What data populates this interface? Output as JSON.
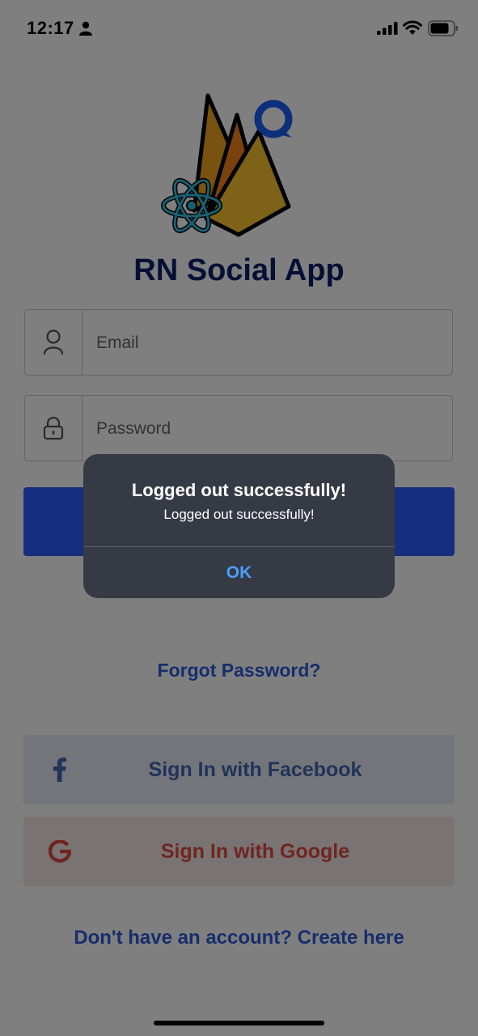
{
  "status_bar": {
    "time": "12:17",
    "icons": [
      "person-icon",
      "cellular-signal-icon",
      "wifi-icon",
      "battery-icon"
    ]
  },
  "app": {
    "title": "RN Social App",
    "logo": "firebase-react-chat-logo"
  },
  "form": {
    "email_placeholder": "Email",
    "email_value": "",
    "password_placeholder": "Password",
    "password_value": "",
    "email_icon": "user-icon",
    "password_icon": "lock-icon"
  },
  "links": {
    "forgot_password": "Forgot Password?",
    "create_account": "Don't have an account? Create here"
  },
  "social": {
    "facebook_label": "Sign In with Facebook",
    "facebook_icon": "facebook-icon",
    "google_label": "Sign In with Google",
    "google_icon": "google-icon"
  },
  "alert": {
    "title": "Logged out successfully!",
    "message": "Logged out successfully!",
    "ok_label": "OK"
  },
  "colors": {
    "title": "#0d1f6b",
    "primary_button": "#2e5bff",
    "link": "#2e5bd8",
    "facebook_bg": "#e6eaf4",
    "facebook_text": "#4267b2",
    "google_bg": "#f4e7e9",
    "google_text": "#de4d41",
    "alert_bg": "#353a45",
    "alert_button": "#4d9dff"
  }
}
